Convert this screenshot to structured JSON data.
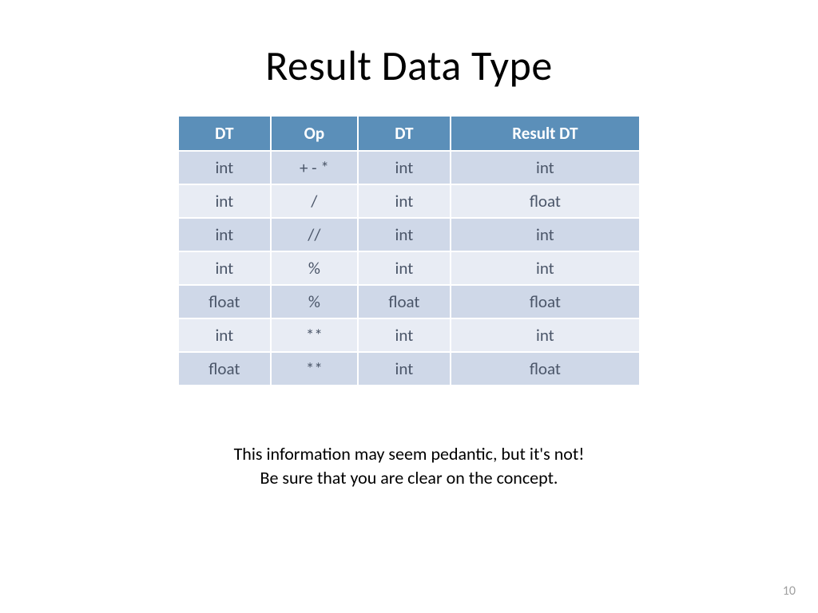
{
  "title": "Result Data Type",
  "table": {
    "headers": [
      "DT",
      "Op",
      "DT",
      "Result DT"
    ],
    "rows": [
      [
        "int",
        "+ - *",
        "int",
        "int"
      ],
      [
        "int",
        "/",
        "int",
        "float"
      ],
      [
        "int",
        "//",
        "int",
        "int"
      ],
      [
        "int",
        "%",
        "int",
        "int"
      ],
      [
        "float",
        "%",
        "float",
        "float"
      ],
      [
        "int",
        "**",
        "int",
        "int"
      ],
      [
        "float",
        "**",
        "int",
        "float"
      ]
    ]
  },
  "note_line1": "This information may seem pedantic, but it's not!",
  "note_line2": "Be sure that you are clear on the concept.",
  "page_number": "10"
}
